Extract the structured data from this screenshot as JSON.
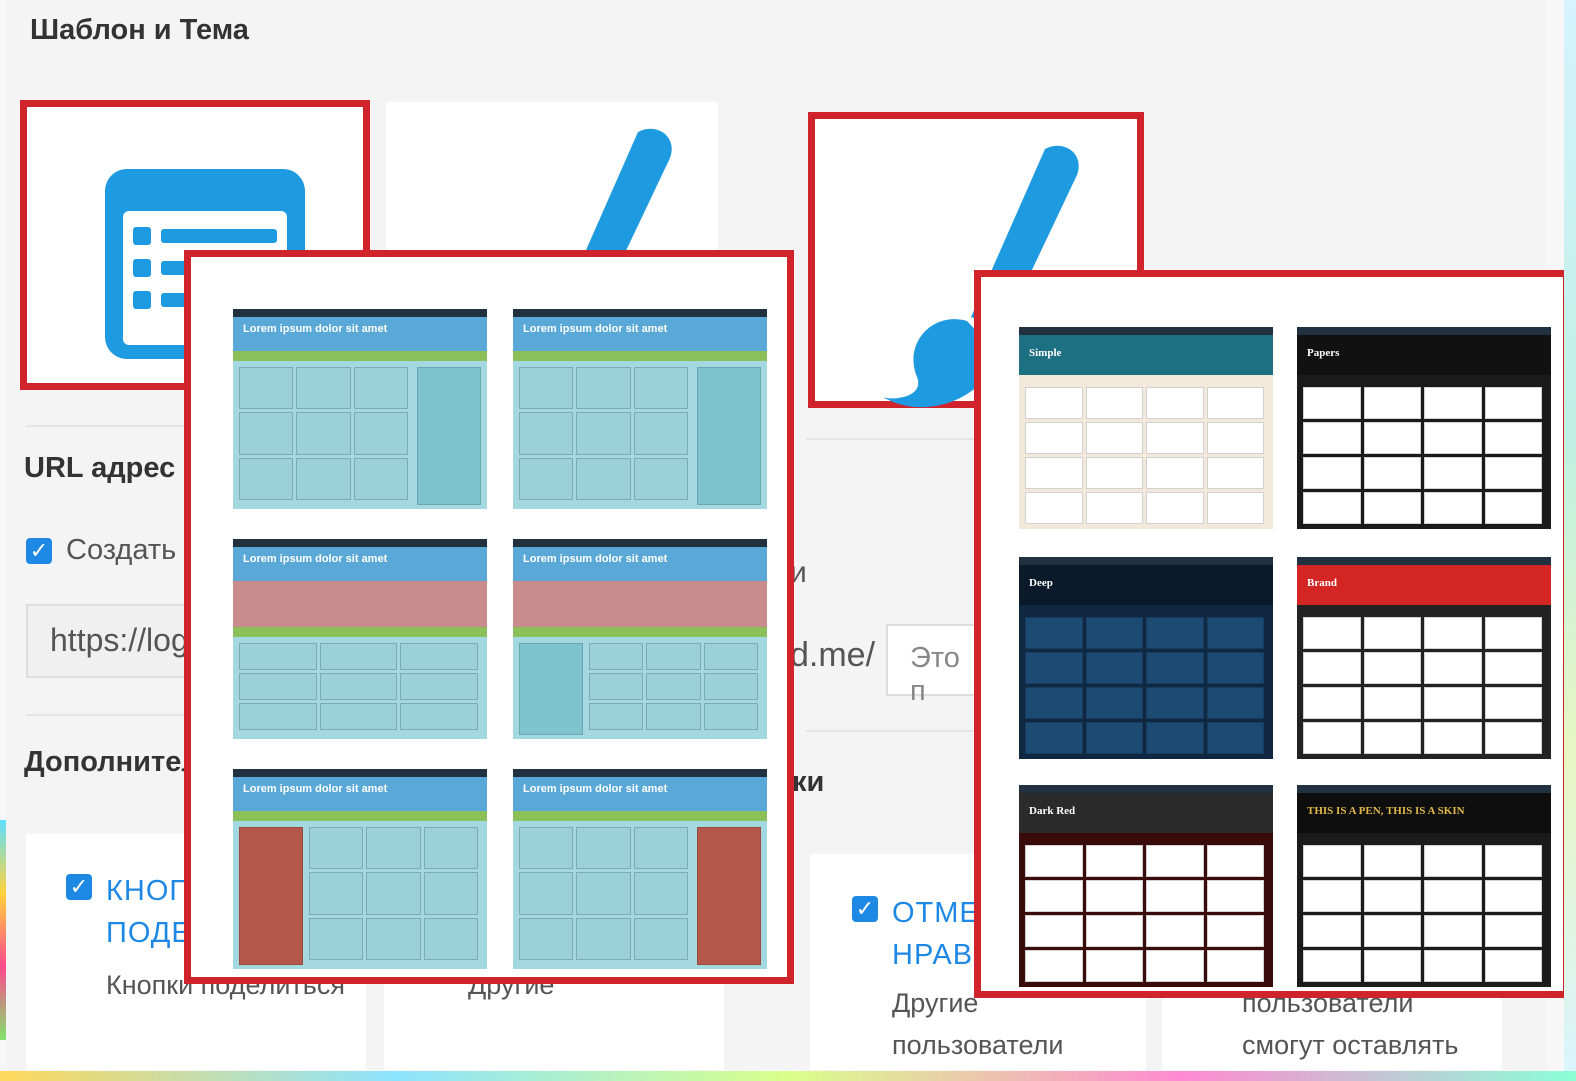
{
  "section_title": "Шаблон и Тема",
  "url_section": {
    "title": "URL адрес с",
    "checkbox_label": "Создать н",
    "url_prefix": "https://logi",
    "domain_suffix": "d.me/",
    "note_placeholder": "Это п",
    "side_text": "и"
  },
  "extra_section": {
    "title": "Дополнител",
    "right_title": "ки"
  },
  "cards": [
    {
      "link": "КНОПК\nПОДЕЛ",
      "desc": "Кнопки поделиться"
    },
    {
      "link": "",
      "desc": "Другие"
    },
    {
      "link": "ОТМЕТ\nНРАВИ",
      "desc": "Другие\nпользователи"
    },
    {
      "link": "",
      "desc": "пользователи\nсмогут оставлять"
    }
  ],
  "template_thumbs": [
    {
      "title": "Lorem ipsum dolor sit amet",
      "accent": "#5aa8d8",
      "body": "#a4d8e0",
      "sidebar": "right",
      "variant": "plain"
    },
    {
      "title": "Lorem ipsum dolor sit amet",
      "accent": "#5aa8d8",
      "body": "#a4d8e0",
      "sidebar": "right",
      "variant": "plain"
    },
    {
      "title": "Lorem ipsum dolor sit amet",
      "accent": "#5aa8d8",
      "body": "#a4d8e0",
      "sidebar": "none",
      "variant": "banner"
    },
    {
      "title": "Lorem ipsum dolor sit amet",
      "accent": "#5aa8d8",
      "body": "#a4d8e0",
      "sidebar": "left",
      "variant": "banner"
    },
    {
      "title": "Lorem ipsum dolor sit amet",
      "accent": "#5aa8d8",
      "body": "#a4d8e0",
      "sidebar": "left",
      "variant": "split"
    },
    {
      "title": "Lorem ipsum dolor sit amet",
      "accent": "#5aa8d8",
      "body": "#a4d8e0",
      "sidebar": "right",
      "variant": "split"
    }
  ],
  "theme_thumbs": [
    {
      "title": "Simple",
      "header": "#1d6f82",
      "body": "#f3e9db",
      "cell": "#ffffff"
    },
    {
      "title": "Papers",
      "header": "#111111",
      "body": "#1a1a1a",
      "cell": "#ffffff"
    },
    {
      "title": "Deep",
      "header": "#0b1a2b",
      "body": "#0f2740",
      "cell": "#1c4a73"
    },
    {
      "title": "Brand",
      "header": "#d42525",
      "body": "#222222",
      "cell": "#ffffff"
    },
    {
      "title": "Dark Red",
      "header": "#2b2b2b",
      "body": "#3a0b0b",
      "cell": "#ffffff"
    },
    {
      "title": "THIS IS A PEN, THIS IS A SKIN",
      "header": "#0e0e0e",
      "body": "#1b1b1b",
      "cell": "#ffffff"
    }
  ],
  "colors": {
    "accent": "#1e88e5",
    "highlight": "#d0232b",
    "icon": "#1e9be0"
  }
}
